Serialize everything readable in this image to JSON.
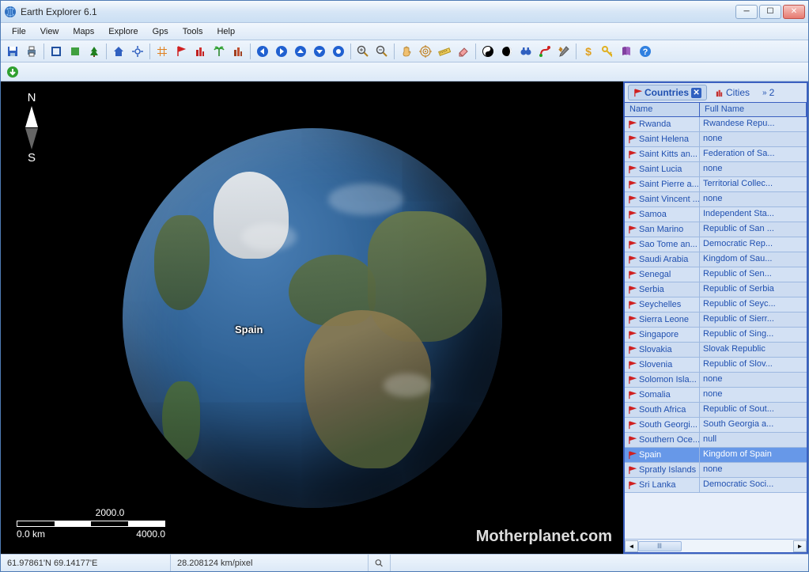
{
  "app": {
    "title": "Earth Explorer 6.1"
  },
  "menu": [
    "File",
    "View",
    "Maps",
    "Explore",
    "Gps",
    "Tools",
    "Help"
  ],
  "toolbar_icons": [
    {
      "name": "save-icon",
      "type": "save"
    },
    {
      "name": "print-icon",
      "type": "print"
    },
    {
      "name": "sep"
    },
    {
      "name": "fullscreen-icon",
      "type": "rect"
    },
    {
      "name": "layer-icon",
      "type": "green-sq"
    },
    {
      "name": "tree-icon",
      "type": "tree"
    },
    {
      "name": "sep"
    },
    {
      "name": "home-icon",
      "type": "home"
    },
    {
      "name": "locate-icon",
      "type": "locate"
    },
    {
      "name": "sep"
    },
    {
      "name": "grid-icon",
      "type": "grid"
    },
    {
      "name": "flag-red-icon",
      "type": "flag-red"
    },
    {
      "name": "city-red-icon",
      "type": "city-red"
    },
    {
      "name": "palm-icon",
      "type": "palm"
    },
    {
      "name": "city-icon",
      "type": "city"
    },
    {
      "name": "sep"
    },
    {
      "name": "nav-left-icon",
      "type": "arrow-l"
    },
    {
      "name": "nav-right-icon",
      "type": "arrow-r"
    },
    {
      "name": "nav-up-icon",
      "type": "arrow-u"
    },
    {
      "name": "nav-down-icon",
      "type": "arrow-d"
    },
    {
      "name": "nav-center-icon",
      "type": "circle"
    },
    {
      "name": "sep"
    },
    {
      "name": "zoom-in-icon",
      "type": "zoom-in"
    },
    {
      "name": "zoom-out-icon",
      "type": "zoom-out"
    },
    {
      "name": "sep"
    },
    {
      "name": "hand-icon",
      "type": "hand"
    },
    {
      "name": "target-icon",
      "type": "target"
    },
    {
      "name": "ruler-icon",
      "type": "ruler"
    },
    {
      "name": "eraser-icon",
      "type": "eraser"
    },
    {
      "name": "sep"
    },
    {
      "name": "yinyang-icon",
      "type": "yinyang"
    },
    {
      "name": "moon-icon",
      "type": "moon"
    },
    {
      "name": "binoculars-icon",
      "type": "binoc"
    },
    {
      "name": "route-icon",
      "type": "route"
    },
    {
      "name": "tools-icon",
      "type": "tools"
    },
    {
      "name": "sep"
    },
    {
      "name": "dollar-icon",
      "type": "dollar"
    },
    {
      "name": "key-icon",
      "type": "key"
    },
    {
      "name": "book-icon",
      "type": "book"
    },
    {
      "name": "help-icon",
      "type": "help"
    }
  ],
  "toolbar2_icons": [
    {
      "name": "download-icon",
      "type": "download"
    }
  ],
  "map": {
    "label": "Spain",
    "compass_n": "N",
    "compass_s": "S",
    "scale_top": "2000.0",
    "scale_left": "0.0 km",
    "scale_right": "4000.0",
    "watermark": "Motherplanet.com"
  },
  "panel": {
    "tabs": [
      {
        "label": "Countries",
        "active": true
      },
      {
        "label": "Cities",
        "active": false
      },
      {
        "label": "2",
        "overflow": true
      }
    ],
    "columns": {
      "name": "Name",
      "full": "Full Name"
    },
    "rows": [
      {
        "name": "Rwanda",
        "full": "Rwandese Repu..."
      },
      {
        "name": "Saint Helena",
        "full": "none"
      },
      {
        "name": "Saint Kitts an...",
        "full": "Federation of Sa..."
      },
      {
        "name": "Saint Lucia",
        "full": "none"
      },
      {
        "name": "Saint Pierre a...",
        "full": "Territorial Collec..."
      },
      {
        "name": "Saint Vincent ...",
        "full": "none"
      },
      {
        "name": "Samoa",
        "full": "Independent Sta..."
      },
      {
        "name": "San Marino",
        "full": "Republic of San ..."
      },
      {
        "name": "Sao Tome an...",
        "full": "Democratic Rep..."
      },
      {
        "name": "Saudi Arabia",
        "full": "Kingdom of Sau..."
      },
      {
        "name": "Senegal",
        "full": "Republic of Sen..."
      },
      {
        "name": "Serbia",
        "full": "Republic of Serbia"
      },
      {
        "name": "Seychelles",
        "full": "Republic of Seyc..."
      },
      {
        "name": "Sierra Leone",
        "full": "Republic of Sierr..."
      },
      {
        "name": "Singapore",
        "full": "Republic of Sing..."
      },
      {
        "name": "Slovakia",
        "full": "Slovak Republic"
      },
      {
        "name": "Slovenia",
        "full": "Republic of Slov..."
      },
      {
        "name": "Solomon Isla...",
        "full": "none"
      },
      {
        "name": "Somalia",
        "full": "none"
      },
      {
        "name": "South Africa",
        "full": "Republic of Sout..."
      },
      {
        "name": "South Georgi...",
        "full": "South Georgia a..."
      },
      {
        "name": "Southern Oce...",
        "full": "null"
      },
      {
        "name": "Spain",
        "full": "Kingdom of Spain",
        "selected": true
      },
      {
        "name": "Spratly Islands",
        "full": "none"
      },
      {
        "name": "Sri Lanka",
        "full": "Democratic Soci..."
      }
    ]
  },
  "status": {
    "coords": "61.97861'N 69.14177'E",
    "resolution": "28.208124 km/pixel"
  }
}
